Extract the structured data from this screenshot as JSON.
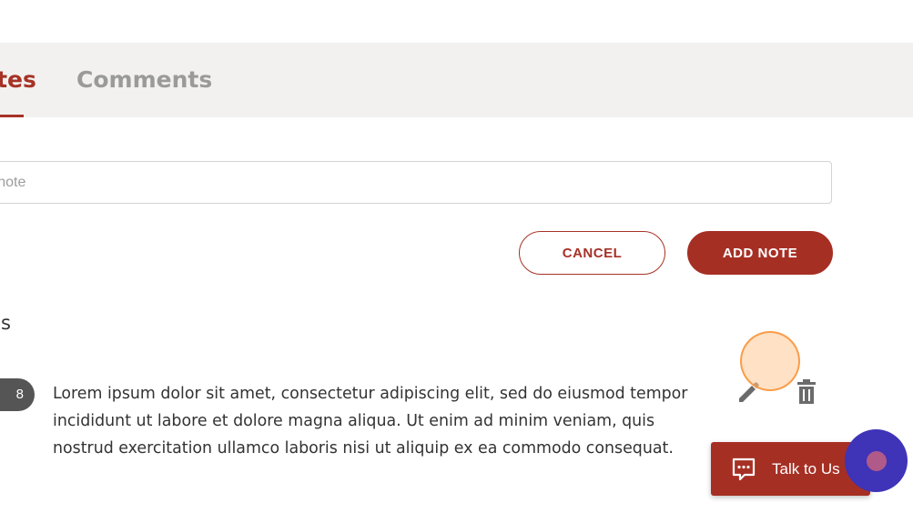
{
  "tabs": [
    {
      "label": "Notes",
      "visible_text": "s",
      "active": true
    },
    {
      "label": "Comments",
      "active": false
    }
  ],
  "note_input": {
    "placeholder": "Add a note",
    "value": ""
  },
  "buttons": {
    "cancel_label": "CANCEL",
    "add_note_label": "ADD NOTE"
  },
  "section": {
    "heading": "Notes",
    "visible_heading": "s"
  },
  "notes": [
    {
      "badge": "8",
      "text": "Lorem ipsum dolor sit amet, consectetur adipiscing elit, sed do eiusmod tempor incididunt ut labore et dolore magna aliqua. Ut enim ad minim veniam, quis nostrud exercitation ullamco laboris nisi ut aliquip ex ea commodo consequat.",
      "icons": [
        "edit-icon",
        "delete-icon"
      ]
    }
  ],
  "chat_widget": {
    "label": "Talk to Us",
    "icon": "chat-message-icon"
  },
  "colors": {
    "accent": "#a62f24",
    "tabbar_bg": "#f2f1ef",
    "badge_bg": "#555555",
    "assistant_bg": "#3f33b8",
    "inactive_tab": "#9a9a9a"
  }
}
